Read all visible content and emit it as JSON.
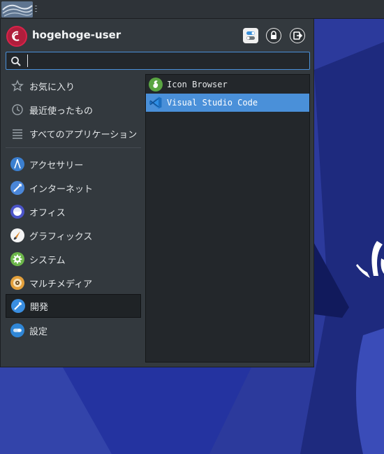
{
  "user": {
    "name": "hogehoge-user"
  },
  "header": {
    "settings_icon": "settings-toggle-icon",
    "lock_icon": "lock-icon",
    "logout_icon": "logout-icon"
  },
  "search": {
    "value": "",
    "placeholder": ""
  },
  "categories": [
    {
      "label": "お気に入り",
      "icon": "star-icon"
    },
    {
      "label": "最近使ったもの",
      "icon": "clock-icon"
    },
    {
      "label": "すべてのアプリケーション",
      "icon": "list-icon"
    },
    {
      "label": "アクセサリー",
      "icon": "accessories-icon"
    },
    {
      "label": "インターネット",
      "icon": "internet-icon"
    },
    {
      "label": "オフィス",
      "icon": "office-icon"
    },
    {
      "label": "グラフィックス",
      "icon": "graphics-icon"
    },
    {
      "label": "システム",
      "icon": "system-gear-icon"
    },
    {
      "label": "マルチメディア",
      "icon": "multimedia-icon"
    },
    {
      "label": "開発",
      "icon": "development-icon",
      "active": true
    },
    {
      "label": "設定",
      "icon": "settings-icon"
    }
  ],
  "apps": [
    {
      "label": "Icon Browser",
      "icon": "icon-browser-icon"
    },
    {
      "label": "Visual Studio Code",
      "icon": "vscode-icon",
      "selected": true
    }
  ],
  "colors": {
    "accent": "#4a90d9",
    "menu_bg": "#33393e",
    "list_bg": "#23272b",
    "wallpaper": "#2b3a9e"
  }
}
